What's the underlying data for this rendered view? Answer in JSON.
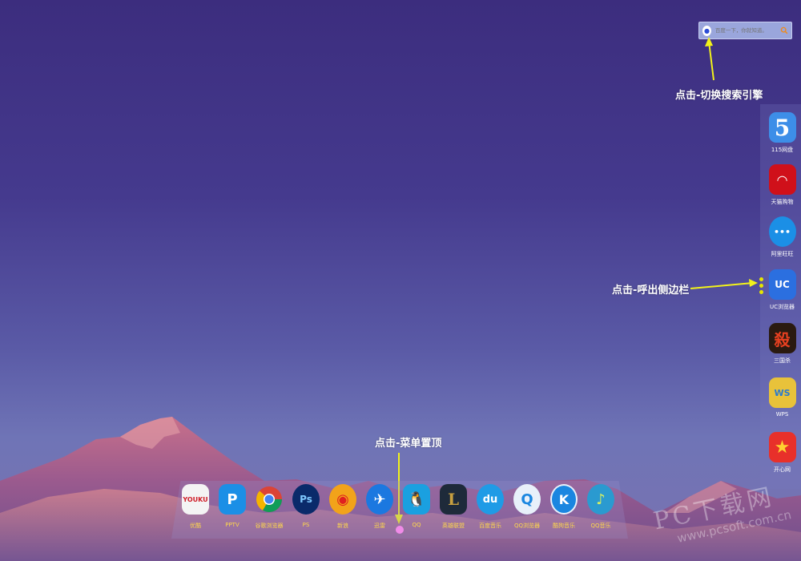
{
  "search": {
    "engine_icon": "baidu-paw-icon",
    "placeholder": "百度一下，你就知道。",
    "button_icon": "search-icon"
  },
  "annotations": {
    "search": "点击-切换搜索引擎",
    "sidebar": "点击-呼出侧边栏",
    "menu": "点击-菜单置顶"
  },
  "sidebar": {
    "items": [
      {
        "label": "115网盘",
        "icon": "115-cloud-icon",
        "glyph": "5",
        "color": "#3d8ee8"
      },
      {
        "label": "天猫购物",
        "icon": "tmall-icon",
        "glyph": "◠",
        "color": "#d0101a"
      },
      {
        "label": "阿里旺旺",
        "icon": "aliwangwang-icon",
        "glyph": "•••",
        "color": "#1b8fe6"
      },
      {
        "label": "UC浏览器",
        "icon": "uc-browser-icon",
        "glyph": "UC",
        "color": "#2b6fe0"
      },
      {
        "label": "三国杀",
        "icon": "sanguosha-icon",
        "glyph": "殺",
        "color": "#2a1a10"
      },
      {
        "label": "WPS",
        "icon": "wps-icon",
        "glyph": "WS",
        "color": "#e8c23a"
      },
      {
        "label": "开心网",
        "icon": "kaixin-icon",
        "glyph": "★",
        "color": "#e8302a"
      }
    ]
  },
  "dock": {
    "items": [
      {
        "label": "优酷",
        "icon": "youku-icon",
        "glyph": "YOUKU",
        "color": "#f4f4f4"
      },
      {
        "label": "PPTV",
        "icon": "pptv-icon",
        "glyph": "P",
        "color": "#1b8fe6"
      },
      {
        "label": "谷歌浏览器",
        "icon": "chrome-icon",
        "glyph": "",
        "color": "#ffffff"
      },
      {
        "label": "PS",
        "icon": "photoshop-icon",
        "glyph": "Ps",
        "color": "#0a2a6a"
      },
      {
        "label": "新浪",
        "icon": "weibo-icon",
        "glyph": "◉",
        "color": "#f2a31a"
      },
      {
        "label": "迅雷",
        "icon": "xunlei-icon",
        "glyph": "✈",
        "color": "#1b78e0"
      },
      {
        "label": "QQ",
        "icon": "qq-icon",
        "glyph": "🐧",
        "color": "#1aa0e0"
      },
      {
        "label": "英雄联盟",
        "icon": "league-icon",
        "glyph": "L",
        "color": "#1e2a3a"
      },
      {
        "label": "百度音乐",
        "icon": "baidu-music-icon",
        "glyph": "du",
        "color": "#1f9be6"
      },
      {
        "label": "QQ浏览器",
        "icon": "qq-browser-icon",
        "glyph": "Q",
        "color": "#e8f0fa"
      },
      {
        "label": "酷狗音乐",
        "icon": "kugou-icon",
        "glyph": "K",
        "color": "#1a86e0"
      },
      {
        "label": "QQ音乐",
        "icon": "qq-music-icon",
        "glyph": "♪",
        "color": "#2a9ad0"
      }
    ]
  },
  "watermark": {
    "text": "PC下载网",
    "url": "www.pcsoft.com.cn"
  }
}
